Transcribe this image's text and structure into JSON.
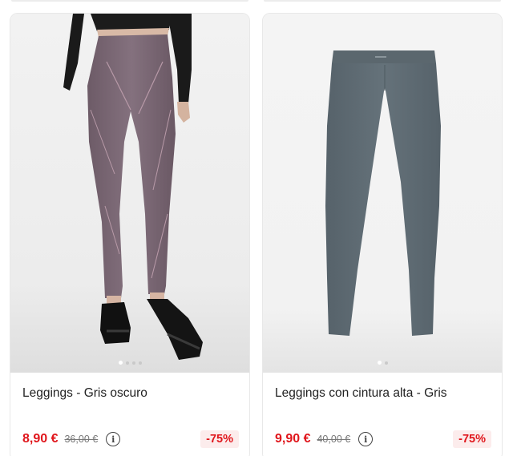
{
  "products": [
    {
      "image_alt": "Leggings - Gris oscuro",
      "title": "Leggings - Gris oscuro",
      "price": "8,90 €",
      "old_price": "36,00 €",
      "discount": "-75%",
      "carousel": {
        "count": 4,
        "active_index": 0
      },
      "colors": {
        "garment": "#7d6a77",
        "shoes": "#111111",
        "top": "#1a1a1a"
      }
    },
    {
      "image_alt": "Leggings con cintura alta - Gris",
      "title": "Leggings con cintura alta - Gris",
      "price": "9,90 €",
      "old_price": "40,00 €",
      "discount": "-75%",
      "carousel": {
        "count": 2,
        "active_index": 0
      },
      "colors": {
        "garment": "#5e6a6c"
      }
    }
  ],
  "icons": {
    "info": "info-icon"
  },
  "theme": {
    "price_color": "#e0161c",
    "badge_bg": "#fcecec"
  }
}
